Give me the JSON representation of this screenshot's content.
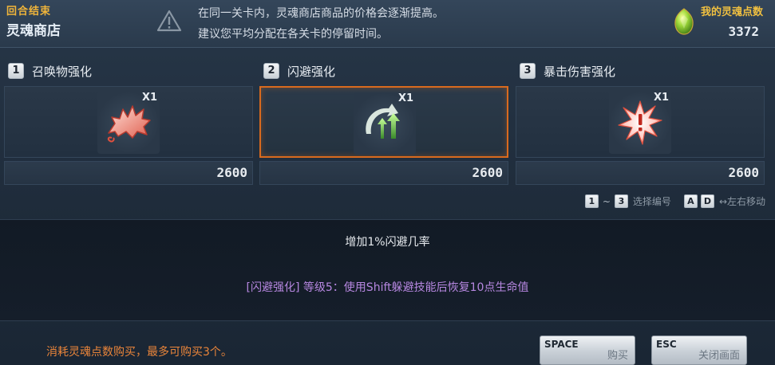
{
  "header": {
    "round_end": "回合结束",
    "shop_title": "灵魂商店",
    "notice_line1": "在同一关卡内，灵魂商店商品的价格会逐渐提高。",
    "notice_line2": "建议您平均分配在各关卡的停留时间。",
    "points_label": "我的灵魂点数",
    "points_value": "3372"
  },
  "items": [
    {
      "key": "1",
      "name": "召唤物强化",
      "qty": "X1",
      "price": "2600",
      "icon": "beast-summon-icon",
      "selected": false
    },
    {
      "key": "2",
      "name": "闪避强化",
      "qty": "X1",
      "price": "2600",
      "icon": "evade-up-arrows-icon",
      "selected": true
    },
    {
      "key": "3",
      "name": "暴击伤害强化",
      "qty": "X1",
      "price": "2600",
      "icon": "critical-burst-icon",
      "selected": false
    }
  ],
  "hints": {
    "key_from": "1",
    "tilde": "~",
    "key_to": "3",
    "select_label": "选择编号",
    "key_a": "A",
    "key_d": "D",
    "move_label": "↔左右移动"
  },
  "description": {
    "main": "增加1%闪避几率",
    "detail": "[闪避强化] 等级5：使用Shift躲避技能后恢复10点生命值"
  },
  "footer": {
    "note": "消耗灵魂点数购买，最多可购买3个。",
    "buy_key": "SPACE",
    "buy_label": "购买",
    "close_key": "ESC",
    "close_label": "关闭画面"
  },
  "colors": {
    "accent_gold": "#f0b53a",
    "selected_border": "#d96a1e",
    "detail_purple": "#b687e0",
    "note_orange": "#e8843a"
  }
}
